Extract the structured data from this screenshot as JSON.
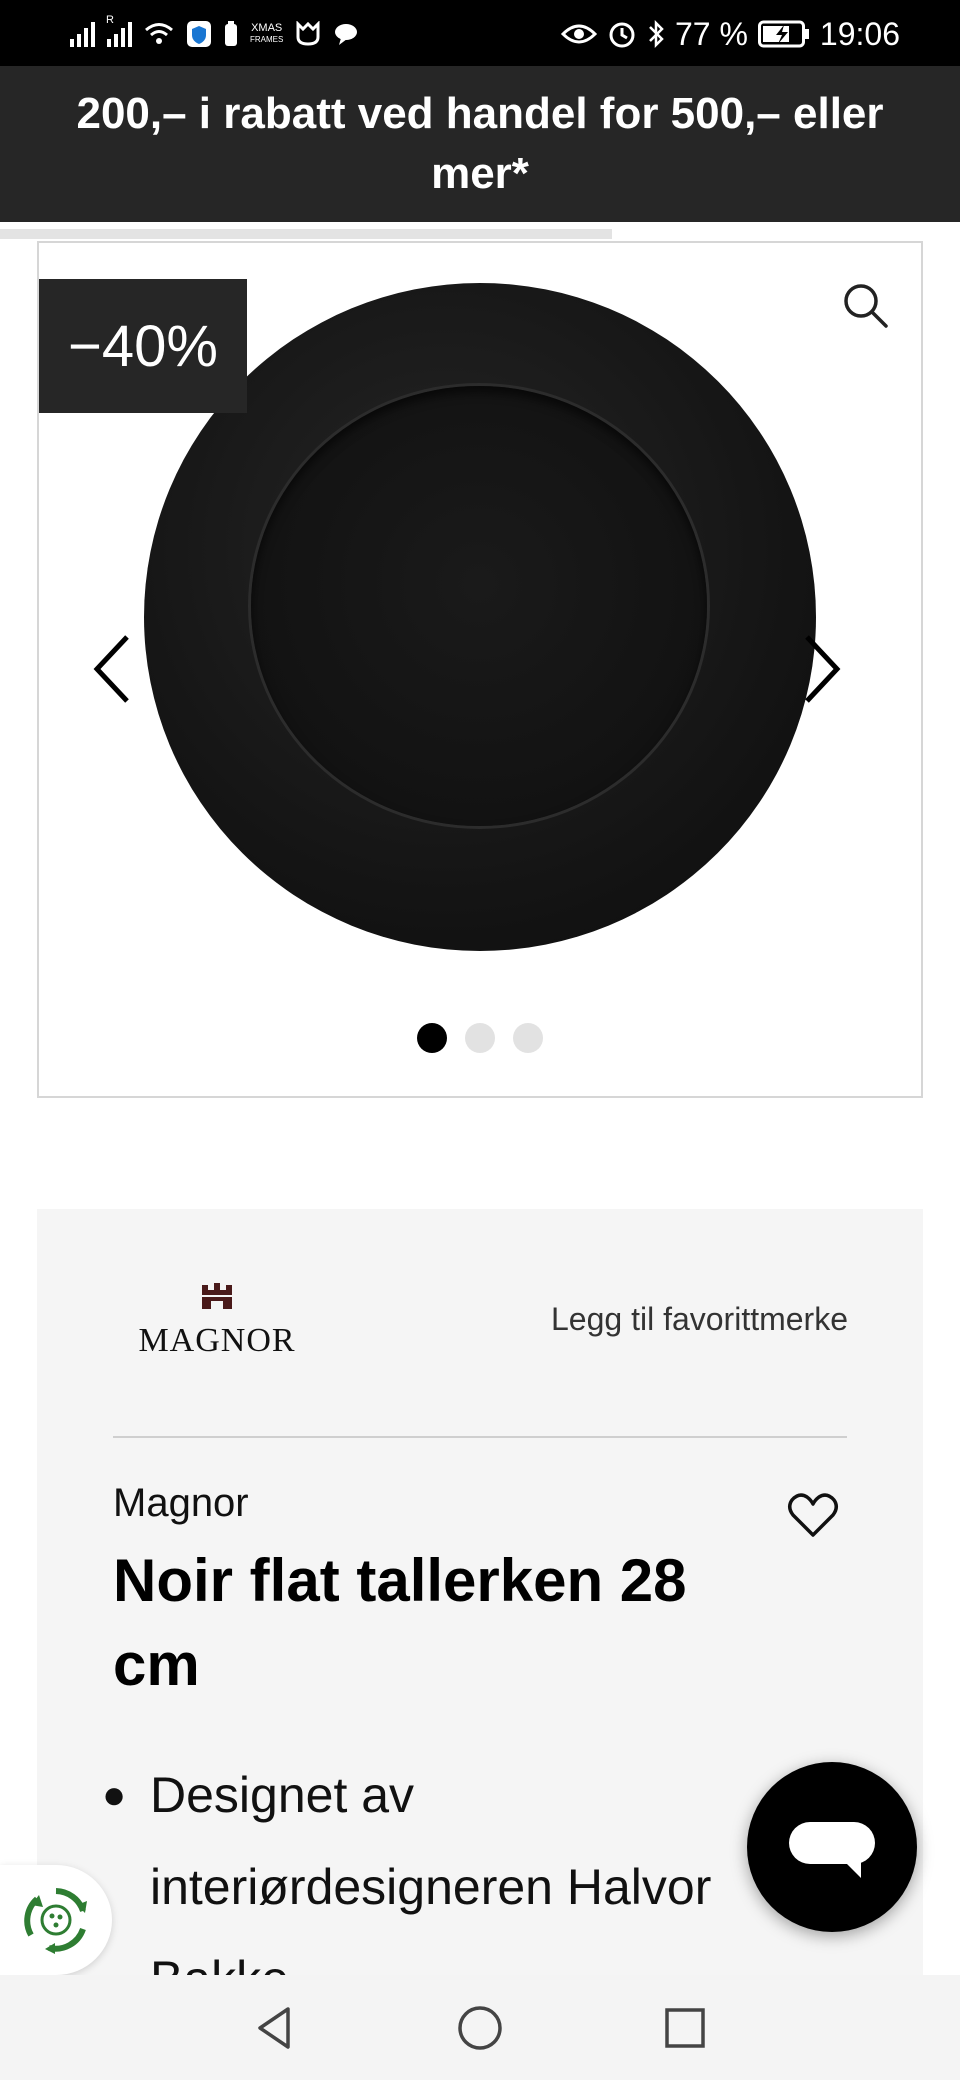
{
  "status_bar": {
    "sim_label": "R",
    "xmas_label_1": "XMAS",
    "xmas_label_2": "FRAMES",
    "battery_text": "77 %",
    "time": "19:06"
  },
  "promo": {
    "text": "200,– i rabatt ved handel for 500,– eller mer*"
  },
  "gallery": {
    "discount_badge": "−40%",
    "current_image": 1,
    "image_count": 3
  },
  "product": {
    "brand_logo_text": "MAGNOR",
    "add_favorite_brand": "Legg til favorittmerke",
    "brand": "Magnor",
    "title": "Noir flat tallerken 28 cm",
    "bullet_1": "Designet av interiørdesigneren Halvor Bakke"
  },
  "colors": {
    "banner_bg": "#262626",
    "card_bg": "#f5f5f5",
    "eco_green": "#2e7d32",
    "chat_bg": "#000000"
  },
  "icons": {
    "zoom": "magnifier-icon",
    "prev": "chevron-left-icon",
    "next": "chevron-right-icon",
    "favorite": "heart-icon",
    "eco": "recycle-icon",
    "chat": "chat-bubble-icon"
  }
}
